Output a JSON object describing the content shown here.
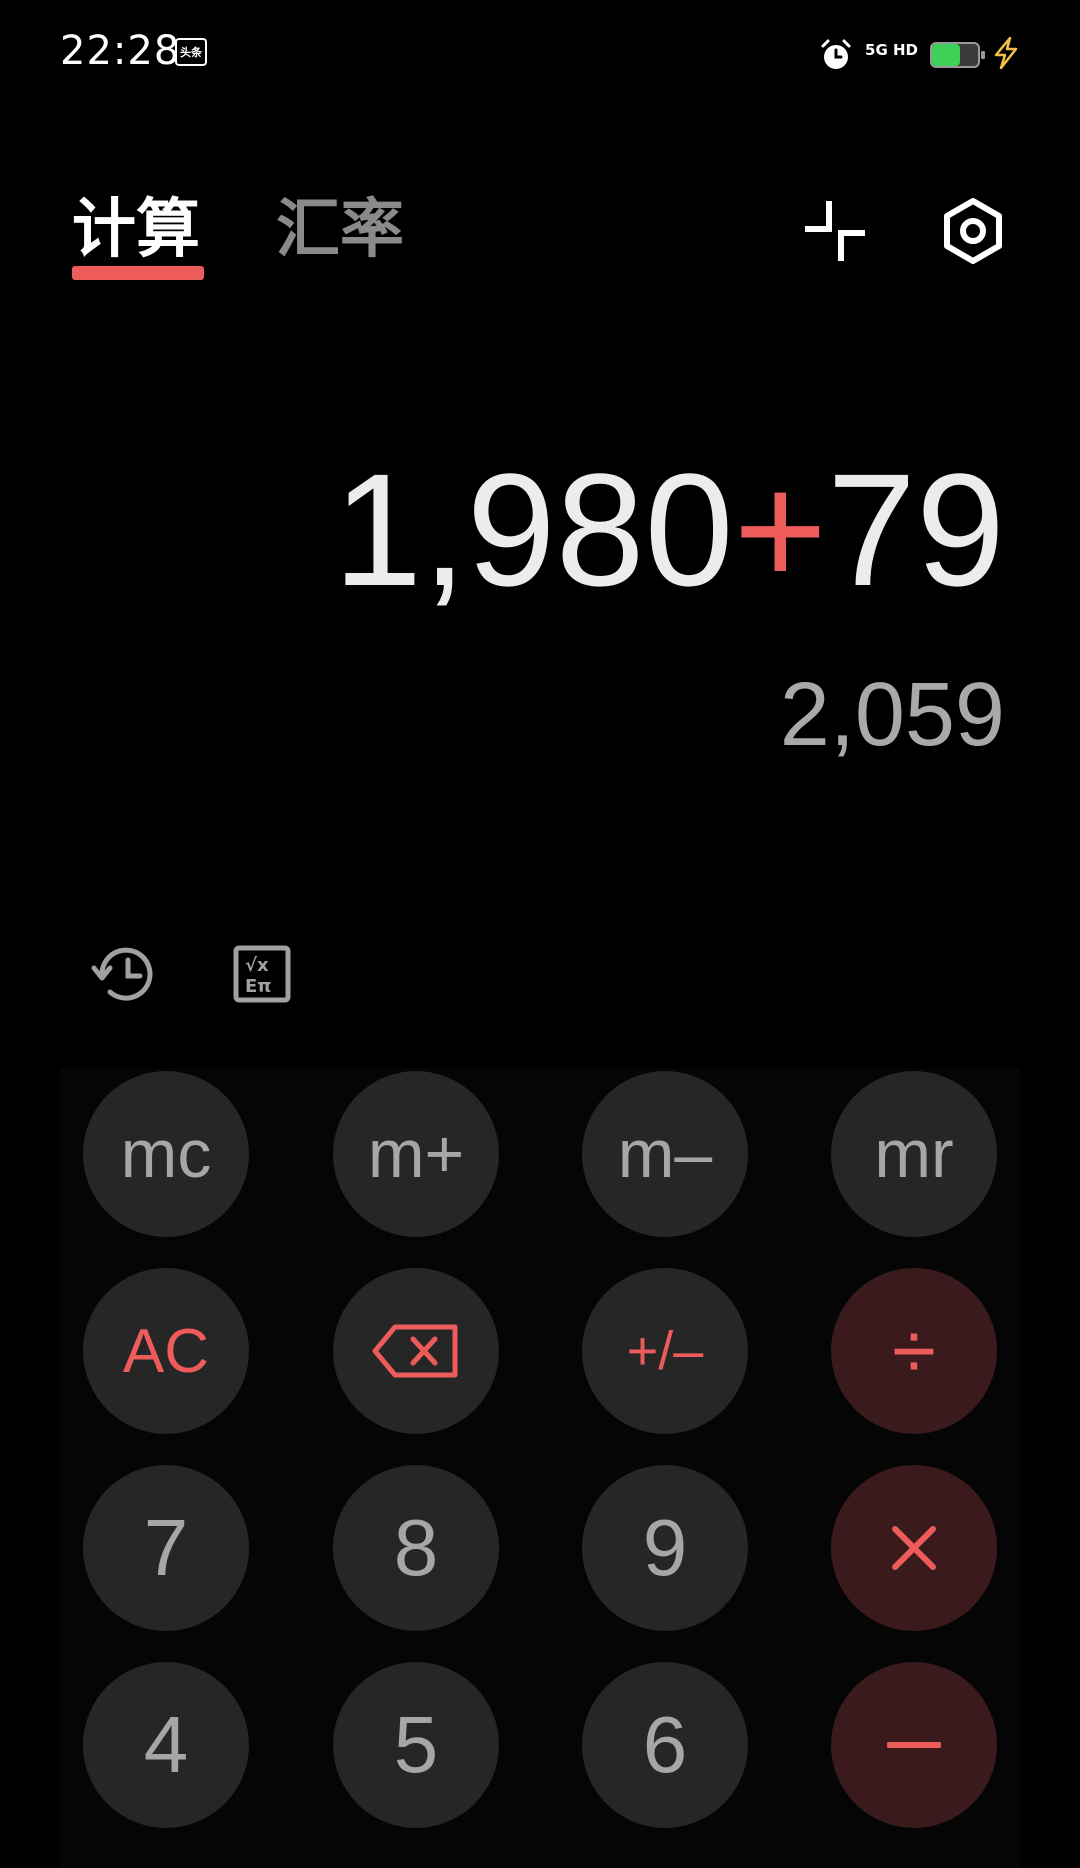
{
  "status_bar": {
    "time": "22:28",
    "app_icon_label": "头条",
    "network_label_top": "5G HD",
    "battery_level": 0.6,
    "battery_color": "#3ed158",
    "charging_color": "#f5c04a",
    "icons": [
      "alarm-icon",
      "charging-icon"
    ]
  },
  "header": {
    "tabs": [
      {
        "label": "计算",
        "active": true
      },
      {
        "label": "汇率",
        "active": false
      }
    ],
    "accent_color": "#ee5b5b",
    "actions": [
      "collapse-icon",
      "settings-icon"
    ]
  },
  "display": {
    "expression_left": "1,980",
    "expression_operator": "+",
    "expression_right": "79",
    "result": "2,059"
  },
  "tools": [
    "history-icon",
    "scientific-icon"
  ],
  "keypad": {
    "row1": [
      "mc",
      "m+",
      "m−",
      "mr"
    ],
    "row2": [
      "AC",
      "backspace",
      "+/−",
      "÷"
    ],
    "row3": [
      "7",
      "8",
      "9",
      "×"
    ],
    "row4": [
      "4",
      "5",
      "6",
      "−"
    ],
    "labels": {
      "mc": "mc",
      "mplus": "m+",
      "mminus": "m–",
      "mr": "mr",
      "ac": "AC",
      "sign": "+/–",
      "divide": "÷",
      "seven": "7",
      "eight": "8",
      "nine": "9",
      "four": "4",
      "five": "5",
      "six": "6"
    },
    "colors": {
      "key_bg": "#262626",
      "operator_bg": "#3a1a1c",
      "operator_fg": "#ee5b5b",
      "digit_fg": "#a6a6a6"
    }
  }
}
